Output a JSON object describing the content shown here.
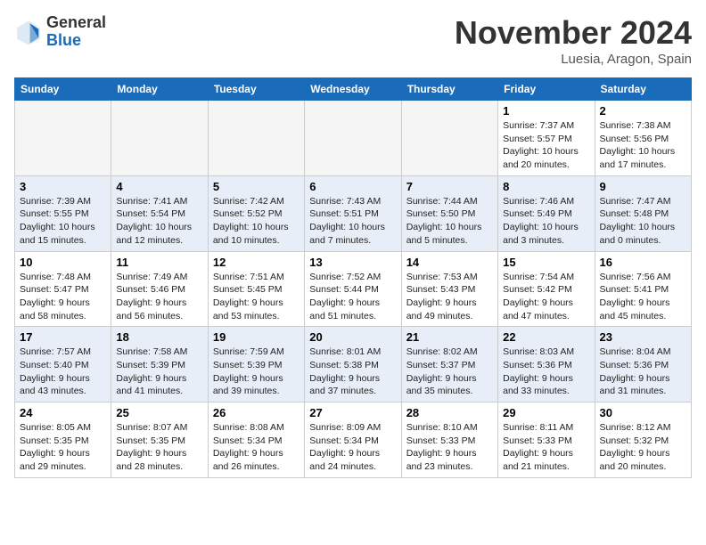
{
  "header": {
    "logo": {
      "general": "General",
      "blue": "Blue"
    },
    "month": "November 2024",
    "location": "Luesia, Aragon, Spain"
  },
  "weekdays": [
    "Sunday",
    "Monday",
    "Tuesday",
    "Wednesday",
    "Thursday",
    "Friday",
    "Saturday"
  ],
  "weeks": [
    [
      {
        "day": "",
        "info": ""
      },
      {
        "day": "",
        "info": ""
      },
      {
        "day": "",
        "info": ""
      },
      {
        "day": "",
        "info": ""
      },
      {
        "day": "",
        "info": ""
      },
      {
        "day": "1",
        "info": "Sunrise: 7:37 AM\nSunset: 5:57 PM\nDaylight: 10 hours and 20 minutes."
      },
      {
        "day": "2",
        "info": "Sunrise: 7:38 AM\nSunset: 5:56 PM\nDaylight: 10 hours and 17 minutes."
      }
    ],
    [
      {
        "day": "3",
        "info": "Sunrise: 7:39 AM\nSunset: 5:55 PM\nDaylight: 10 hours and 15 minutes."
      },
      {
        "day": "4",
        "info": "Sunrise: 7:41 AM\nSunset: 5:54 PM\nDaylight: 10 hours and 12 minutes."
      },
      {
        "day": "5",
        "info": "Sunrise: 7:42 AM\nSunset: 5:52 PM\nDaylight: 10 hours and 10 minutes."
      },
      {
        "day": "6",
        "info": "Sunrise: 7:43 AM\nSunset: 5:51 PM\nDaylight: 10 hours and 7 minutes."
      },
      {
        "day": "7",
        "info": "Sunrise: 7:44 AM\nSunset: 5:50 PM\nDaylight: 10 hours and 5 minutes."
      },
      {
        "day": "8",
        "info": "Sunrise: 7:46 AM\nSunset: 5:49 PM\nDaylight: 10 hours and 3 minutes."
      },
      {
        "day": "9",
        "info": "Sunrise: 7:47 AM\nSunset: 5:48 PM\nDaylight: 10 hours and 0 minutes."
      }
    ],
    [
      {
        "day": "10",
        "info": "Sunrise: 7:48 AM\nSunset: 5:47 PM\nDaylight: 9 hours and 58 minutes."
      },
      {
        "day": "11",
        "info": "Sunrise: 7:49 AM\nSunset: 5:46 PM\nDaylight: 9 hours and 56 minutes."
      },
      {
        "day": "12",
        "info": "Sunrise: 7:51 AM\nSunset: 5:45 PM\nDaylight: 9 hours and 53 minutes."
      },
      {
        "day": "13",
        "info": "Sunrise: 7:52 AM\nSunset: 5:44 PM\nDaylight: 9 hours and 51 minutes."
      },
      {
        "day": "14",
        "info": "Sunrise: 7:53 AM\nSunset: 5:43 PM\nDaylight: 9 hours and 49 minutes."
      },
      {
        "day": "15",
        "info": "Sunrise: 7:54 AM\nSunset: 5:42 PM\nDaylight: 9 hours and 47 minutes."
      },
      {
        "day": "16",
        "info": "Sunrise: 7:56 AM\nSunset: 5:41 PM\nDaylight: 9 hours and 45 minutes."
      }
    ],
    [
      {
        "day": "17",
        "info": "Sunrise: 7:57 AM\nSunset: 5:40 PM\nDaylight: 9 hours and 43 minutes."
      },
      {
        "day": "18",
        "info": "Sunrise: 7:58 AM\nSunset: 5:39 PM\nDaylight: 9 hours and 41 minutes."
      },
      {
        "day": "19",
        "info": "Sunrise: 7:59 AM\nSunset: 5:39 PM\nDaylight: 9 hours and 39 minutes."
      },
      {
        "day": "20",
        "info": "Sunrise: 8:01 AM\nSunset: 5:38 PM\nDaylight: 9 hours and 37 minutes."
      },
      {
        "day": "21",
        "info": "Sunrise: 8:02 AM\nSunset: 5:37 PM\nDaylight: 9 hours and 35 minutes."
      },
      {
        "day": "22",
        "info": "Sunrise: 8:03 AM\nSunset: 5:36 PM\nDaylight: 9 hours and 33 minutes."
      },
      {
        "day": "23",
        "info": "Sunrise: 8:04 AM\nSunset: 5:36 PM\nDaylight: 9 hours and 31 minutes."
      }
    ],
    [
      {
        "day": "24",
        "info": "Sunrise: 8:05 AM\nSunset: 5:35 PM\nDaylight: 9 hours and 29 minutes."
      },
      {
        "day": "25",
        "info": "Sunrise: 8:07 AM\nSunset: 5:35 PM\nDaylight: 9 hours and 28 minutes."
      },
      {
        "day": "26",
        "info": "Sunrise: 8:08 AM\nSunset: 5:34 PM\nDaylight: 9 hours and 26 minutes."
      },
      {
        "day": "27",
        "info": "Sunrise: 8:09 AM\nSunset: 5:34 PM\nDaylight: 9 hours and 24 minutes."
      },
      {
        "day": "28",
        "info": "Sunrise: 8:10 AM\nSunset: 5:33 PM\nDaylight: 9 hours and 23 minutes."
      },
      {
        "day": "29",
        "info": "Sunrise: 8:11 AM\nSunset: 5:33 PM\nDaylight: 9 hours and 21 minutes."
      },
      {
        "day": "30",
        "info": "Sunrise: 8:12 AM\nSunset: 5:32 PM\nDaylight: 9 hours and 20 minutes."
      }
    ]
  ]
}
